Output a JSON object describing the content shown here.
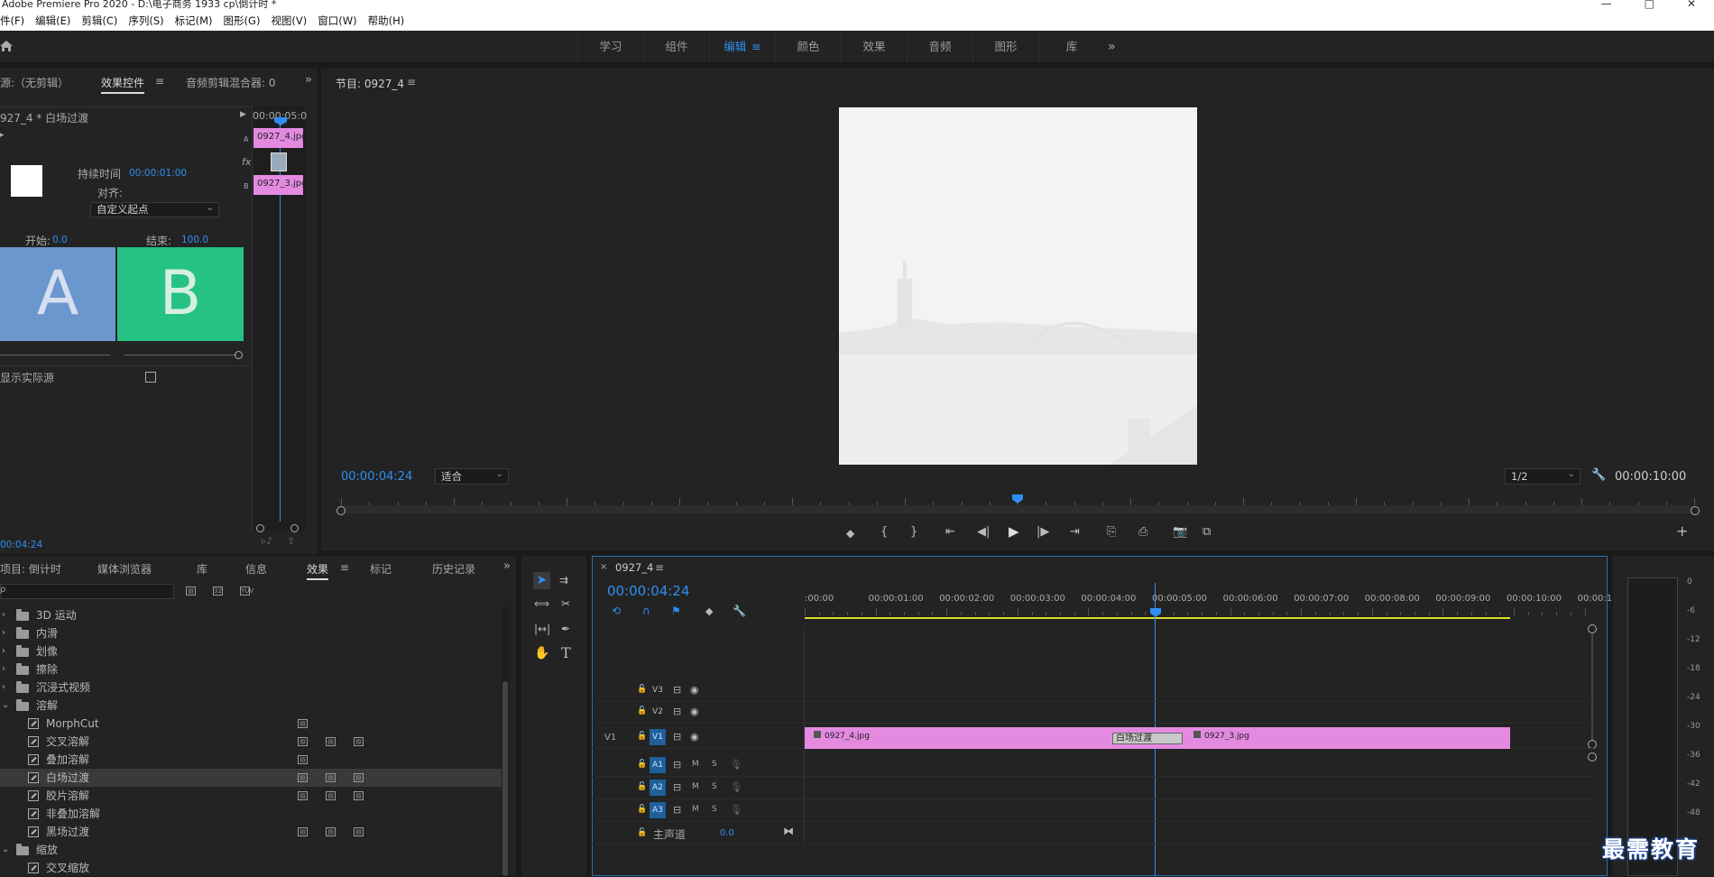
{
  "app": {
    "title": "Adobe Premiere Pro 2020 - D:\\电子商务 1933 cp\\倒计时 *",
    "window_controls": [
      "—",
      "□",
      "✕"
    ]
  },
  "menu": [
    "件(F)",
    "编辑(E)",
    "剪辑(C)",
    "序列(S)",
    "标记(M)",
    "图形(G)",
    "视图(V)",
    "窗口(W)",
    "帮助(H)"
  ],
  "workspaces": {
    "items": [
      "学习",
      "组件",
      "编辑",
      "颜色",
      "效果",
      "音频",
      "图形",
      "库"
    ],
    "active": "编辑",
    "menu_icon": "≡",
    "more": "»"
  },
  "effect_controls": {
    "tabs": [
      "源:（无剪辑）",
      "效果控件",
      "音频剪辑混合器: 0"
    ],
    "active_tab": "效果控件",
    "clip_title": "927_4 * 白场过渡",
    "mini_timecode": "00:00:05:0",
    "duration_label": "持续时间",
    "duration_value": "00:00:01:00",
    "align_label": "对齐:",
    "align_value": "自定义起点",
    "start_label": "开始:",
    "start_value": "0.0",
    "end_label": "结束:",
    "end_value": "100.0",
    "a_label": "A",
    "b_label": "B",
    "clip_a": "0927_4.jpg",
    "clip_b": "0927_3.jpg",
    "track_a": "A",
    "track_b": "B",
    "fx": "fx",
    "show_actual": "显示实际源",
    "bottom_timecode": "00:04:24"
  },
  "program": {
    "tab": "节目: 0927_4",
    "timecode": "00:00:04:24",
    "fit": "适合",
    "resolution": "1/2",
    "duration": "00:00:10:00",
    "playhead_fraction": 0.5
  },
  "project_panel": {
    "tabs": [
      "项目: 倒计时",
      "媒体浏览器",
      "库",
      "信息",
      "效果",
      "标记",
      "历史记录"
    ],
    "active_tab": "效果",
    "search_value": "",
    "tree": [
      {
        "type": "folder",
        "label": "3D 运动",
        "expanded": false
      },
      {
        "type": "folder",
        "label": "内滑",
        "expanded": false
      },
      {
        "type": "folder",
        "label": "划像",
        "expanded": false
      },
      {
        "type": "folder",
        "label": "擦除",
        "expanded": false
      },
      {
        "type": "folder",
        "label": "沉浸式视频",
        "expanded": false
      },
      {
        "type": "folder",
        "label": "溶解",
        "expanded": true
      },
      {
        "type": "item",
        "label": "MorphCut",
        "badges": 1
      },
      {
        "type": "item",
        "label": "交叉溶解",
        "badges": 3
      },
      {
        "type": "item",
        "label": "叠加溶解",
        "badges": 1
      },
      {
        "type": "item",
        "label": "白场过渡",
        "badges": 3,
        "selected": true
      },
      {
        "type": "item",
        "label": "胶片溶解",
        "badges": 3
      },
      {
        "type": "item",
        "label": "非叠加溶解",
        "badges": 0
      },
      {
        "type": "item",
        "label": "黑场过渡",
        "badges": 3
      },
      {
        "type": "folder",
        "label": "缩放",
        "expanded": true
      },
      {
        "type": "item",
        "label": "交叉缩放",
        "badges": 0
      }
    ]
  },
  "timeline": {
    "tab": "0927_4",
    "timecode": "00:00:04:24",
    "ruler": [
      ":00:00",
      "00:00:01:00",
      "00:00:02:00",
      "00:00:03:00",
      "00:00:04:00",
      "00:00:05:00",
      "00:00:06:00",
      "00:00:07:00",
      "00:00:08:00",
      "00:00:09:00",
      "00:00:10:00",
      "00:00:1"
    ],
    "video_tracks": [
      "V3",
      "V2",
      "V1"
    ],
    "audio_tracks": [
      "A1",
      "A2",
      "A3"
    ],
    "source_patch_v": "V1",
    "master_label": "主声道",
    "master_value": "0.0",
    "clip1": "0927_4.jpg",
    "clip2": "0927_3.jpg",
    "transition": "白场过渡",
    "m": "M",
    "s": "S"
  },
  "meter": {
    "scale": [
      "0",
      "-6",
      "-12",
      "-18",
      "-24",
      "-30",
      "-36",
      "-42",
      "-48"
    ]
  },
  "watermark": "最需教育",
  "colors": {
    "accent": "#2f8ef3",
    "clip": "#e38ae0",
    "a_box": "#6b97cf",
    "b_box": "#26c284",
    "work_area": "#dcdc2a"
  }
}
